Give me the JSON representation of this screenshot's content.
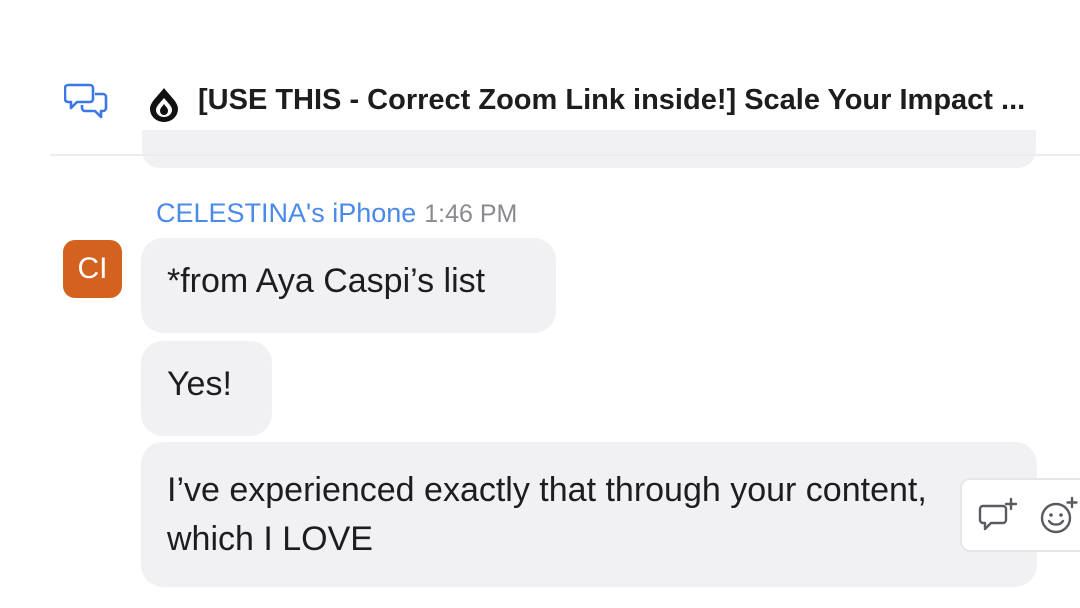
{
  "header": {
    "channel_title": "[USE THIS - Correct Zoom Link inside!] Scale Your Impact ..."
  },
  "message_group": {
    "sender_name": "CELESTINA's iPhone",
    "timestamp": "1:46 PM",
    "avatar_initials": "CI",
    "avatar_color": "#d4621f",
    "messages": [
      {
        "text": "*from Aya Caspi’s list"
      },
      {
        "text": "Yes!"
      },
      {
        "text": "I’ve experienced exactly that through your content, which I LOVE"
      }
    ]
  },
  "colors": {
    "sender_name": "#4a8ae8",
    "bubble_background": "#f1f1f4",
    "chat_icon": "#3a78e6"
  },
  "icons": {
    "header_left": "chat-bubbles-icon",
    "channel": "drop-icon",
    "hover_reply": "reply-thread-icon",
    "hover_reaction": "add-reaction-icon"
  }
}
